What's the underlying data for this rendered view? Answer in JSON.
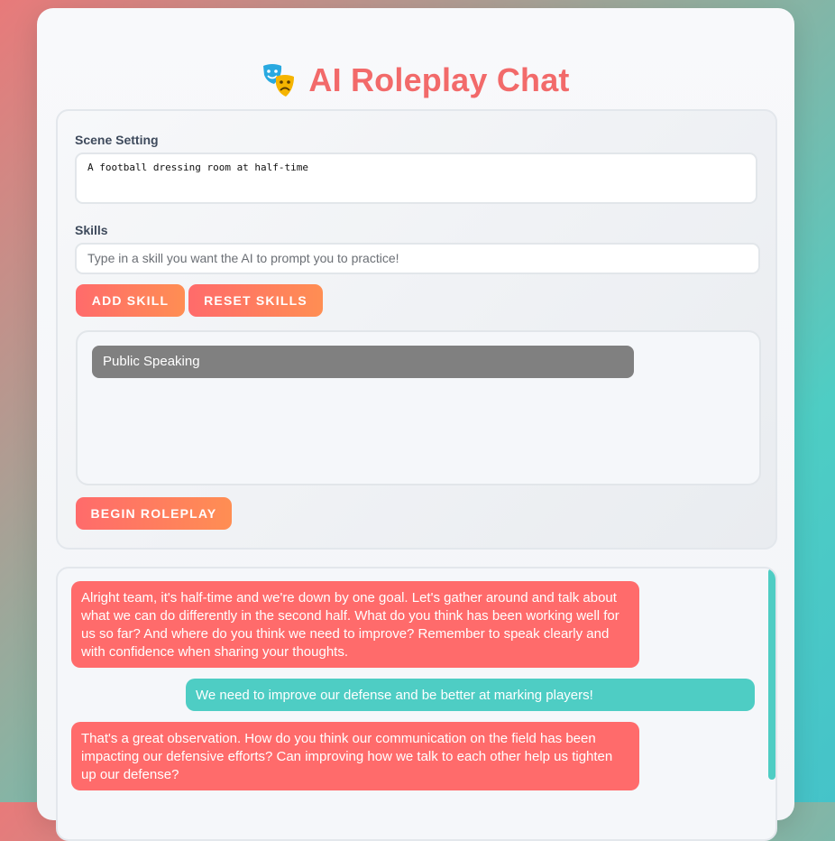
{
  "header": {
    "title": "AI Roleplay Chat",
    "icon": "theater-masks-icon"
  },
  "setup": {
    "scene_label": "Scene Setting",
    "scene_value": "A football dressing room at half-time",
    "skills_label": "Skills",
    "skills_placeholder": "Type in a skill you want the AI to prompt you to practice!",
    "add_skill_label": "ADD SKILL",
    "reset_skills_label": "RESET SKILLS",
    "skills": [
      "Public Speaking"
    ],
    "begin_label": "BEGIN ROLEPLAY"
  },
  "chat": {
    "messages": [
      {
        "role": "ai",
        "text": "Alright team, it's half-time and we're down by one goal. Let's gather around and talk about what we can do differently in the second half. What do you think has been working well for us so far? And where do you think we need to improve? Remember to speak clearly and with confidence when sharing your thoughts."
      },
      {
        "role": "user",
        "text": "We need to improve our defense and be better at marking players!"
      },
      {
        "role": "ai",
        "text": "That's a great observation. How do you think our communication on the field has been impacting our defensive efforts? Can improving how we talk to each other help us tighten up our defense?"
      }
    ]
  },
  "colors": {
    "accent": "#f26a6a",
    "ai_bubble": "#ff6b6b",
    "user_bubble": "#4ecdc4",
    "skill_chip": "#808080"
  }
}
